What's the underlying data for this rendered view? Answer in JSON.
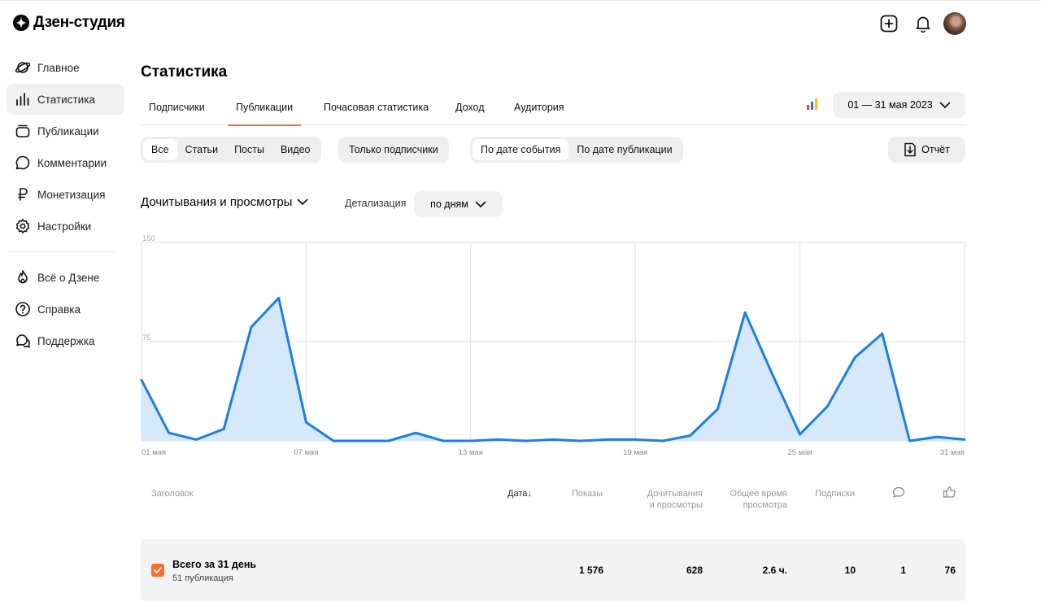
{
  "header": {
    "app_name": "Дзен-студия"
  },
  "sidebar": {
    "items": [
      {
        "label": "Главное",
        "icon": "planet-icon"
      },
      {
        "label": "Статистика",
        "icon": "bar-chart-icon"
      },
      {
        "label": "Публикации",
        "icon": "publications-icon"
      },
      {
        "label": "Комментарии",
        "icon": "comment-icon"
      },
      {
        "label": "Монетизация",
        "icon": "ruble-icon"
      },
      {
        "label": "Настройки",
        "icon": "gear-icon"
      }
    ],
    "secondary": [
      {
        "label": "Всё о Дзене",
        "icon": "flame-icon"
      },
      {
        "label": "Справка",
        "icon": "help-icon"
      },
      {
        "label": "Поддержка",
        "icon": "support-chat-icon"
      }
    ]
  },
  "page": {
    "title": "Статистика"
  },
  "tabs": [
    "Подписчики",
    "Публикации",
    "Почасовая статистика",
    "Доход",
    "Аудитория"
  ],
  "date_range": "01 — 31 мая 2023",
  "filters": {
    "type": [
      "Все",
      "Статьи",
      "Посты",
      "Видео"
    ],
    "subscribers_only": "Только подписчики",
    "date_mode": [
      "По дате события",
      "По дате публикации"
    ],
    "report": "Отчёт"
  },
  "metric": {
    "selected": "Дочитывания и просмотры",
    "detail_label": "Детализация",
    "detail_value": "по дням"
  },
  "chart_data": {
    "type": "area",
    "x_labels": [
      "01 мая",
      "07 мая",
      "13 мая",
      "19 мая",
      "25 мая",
      "31 мая"
    ],
    "y_ticks": [
      "150",
      "75",
      "0"
    ],
    "ylim": [
      0,
      150
    ],
    "x": [
      1,
      2,
      3,
      4,
      5,
      6,
      7,
      8,
      9,
      10,
      11,
      12,
      13,
      14,
      15,
      16,
      17,
      18,
      19,
      20,
      21,
      22,
      23,
      24,
      25,
      26,
      27,
      28,
      29,
      30,
      31
    ],
    "values": [
      46,
      6,
      1,
      9,
      86,
      108,
      14,
      0,
      0,
      0,
      6,
      0,
      0,
      1,
      0,
      1,
      0,
      1,
      1,
      0,
      4,
      24,
      97,
      50,
      5,
      26,
      63,
      81,
      0,
      3,
      1
    ],
    "color": "#1a7fe6",
    "fill": "#d6e9fb"
  },
  "table": {
    "columns": [
      {
        "label": "Заголовок"
      },
      {
        "label": "Дата"
      },
      {
        "label": "Показы"
      },
      {
        "label1": "Дочитывания",
        "label2": "и просмотры"
      },
      {
        "label1": "Общее время",
        "label2": "просмотра"
      },
      {
        "label": "Подписки"
      },
      {
        "icon": "comment-icon"
      },
      {
        "icon": "like-icon"
      }
    ],
    "total": {
      "title": "Всего за 31 день",
      "subtitle": "51 публикация",
      "impressions": "1 576",
      "reads": "628",
      "time": "2.6 ч.",
      "subscriptions": "10",
      "comments": "1",
      "likes": "76"
    }
  }
}
